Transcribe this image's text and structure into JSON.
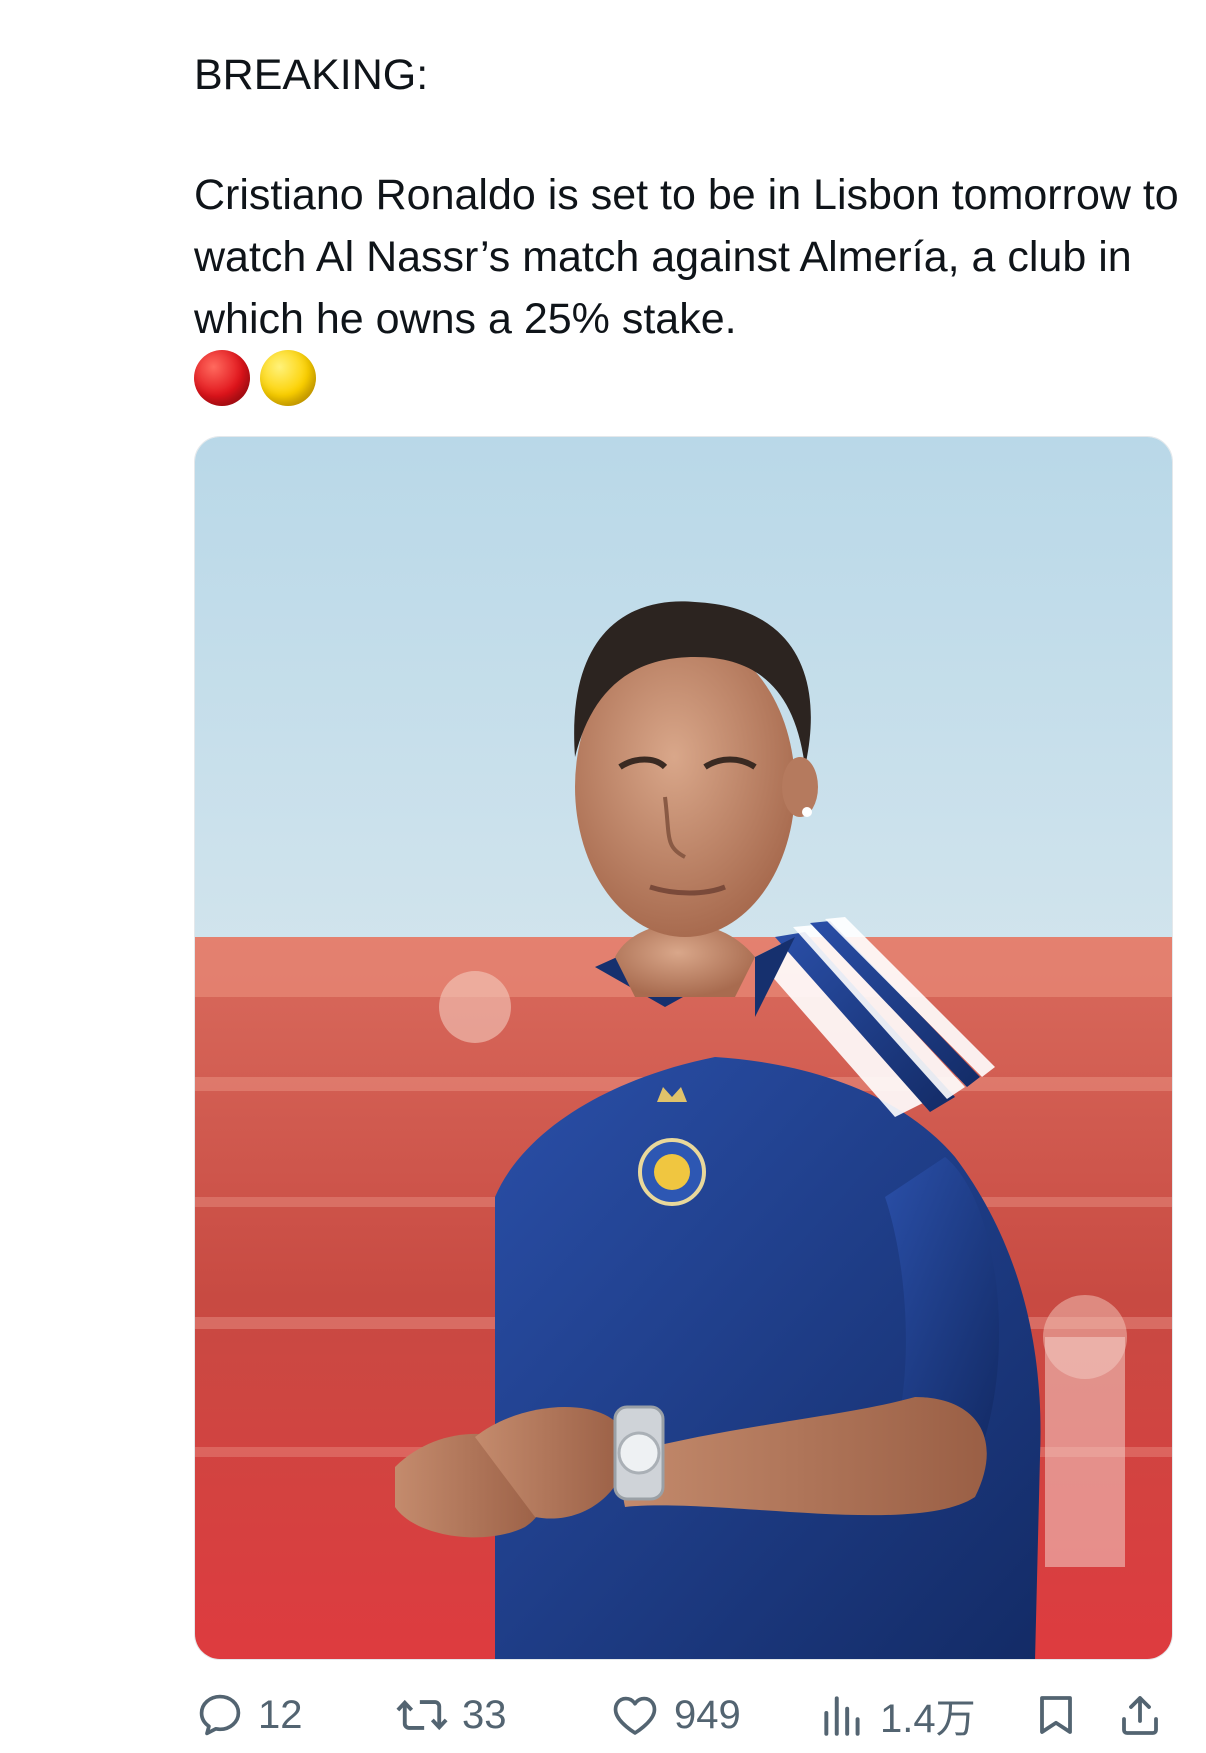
{
  "tweet": {
    "heading": "BREAKING:",
    "body": "Cristiano Ronaldo is set to be in Lisbon tomorrow to watch Al Nassr’s match against Almería, a club in which he owns a 25% stake.",
    "emojis": [
      {
        "name": "red-circle",
        "color": "#e0141b"
      },
      {
        "name": "yellow-circle",
        "color": "#fcd000"
      }
    ]
  },
  "media": {
    "icon": "photo-of-player-in-blue-al-nassr-polo",
    "colors": {
      "sky": "#cfe3ee",
      "stadium": "#d25a4e",
      "shirt": "#1f3f8f"
    }
  },
  "actions": {
    "reply": {
      "icon": "reply-icon",
      "count": "12"
    },
    "retweet": {
      "icon": "retweet-icon",
      "count": "33"
    },
    "like": {
      "icon": "heart-icon",
      "count": "949"
    },
    "views": {
      "icon": "views-icon",
      "count": "1.4万"
    },
    "bookmark": {
      "icon": "bookmark-icon"
    },
    "share": {
      "icon": "share-icon"
    }
  },
  "colors": {
    "text": "#0f1419",
    "muted": "#536471"
  }
}
